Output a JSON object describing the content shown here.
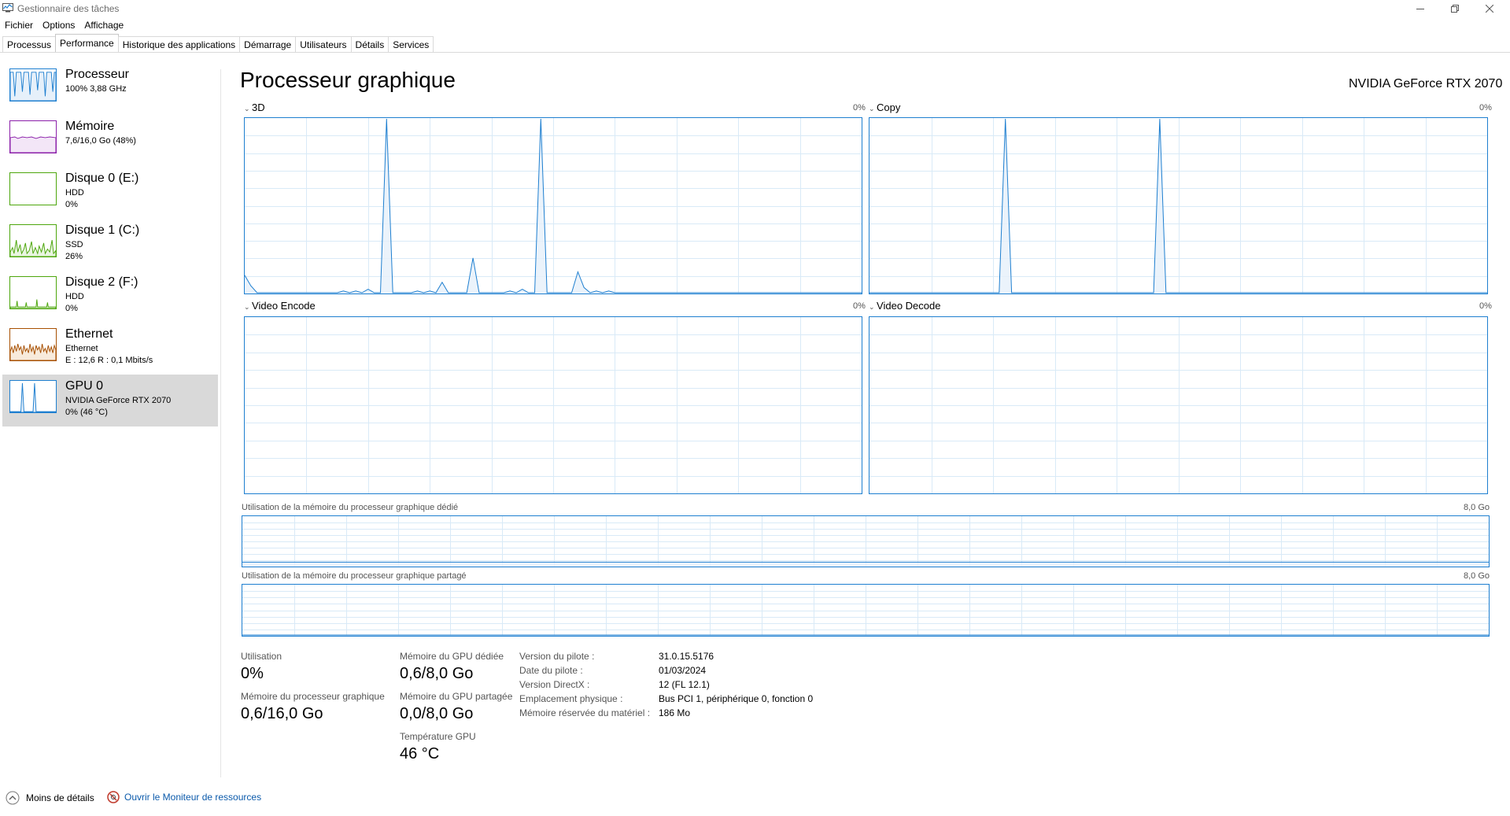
{
  "window": {
    "title": "Gestionnaire des tâches"
  },
  "icons": {
    "app": "task-manager-icon",
    "minimize": "minimize-icon",
    "restore": "restore-icon",
    "close": "close-icon",
    "less_details": "chevron-up-circle-icon",
    "resource_monitor": "resource-monitor-icon"
  },
  "menu": [
    "Fichier",
    "Options",
    "Affichage"
  ],
  "tabs": [
    "Processus",
    "Performance",
    "Historique des applications",
    "Démarrage",
    "Utilisateurs",
    "Détails",
    "Services"
  ],
  "sidebar": [
    {
      "title": "Processeur",
      "lines": [
        "100% 3,88 GHz"
      ],
      "color": "#1e7fd0"
    },
    {
      "title": "Mémoire",
      "lines": [
        "7,6/16,0 Go (48%)"
      ],
      "color": "#8b1fa9"
    },
    {
      "title": "Disque 0 (E:)",
      "lines": [
        "HDD",
        "0%"
      ],
      "color": "#4da60c"
    },
    {
      "title": "Disque 1 (C:)",
      "lines": [
        "SSD",
        "26%"
      ],
      "color": "#4da60c"
    },
    {
      "title": "Disque 2 (F:)",
      "lines": [
        "HDD",
        "0%"
      ],
      "color": "#4da60c"
    },
    {
      "title": "Ethernet",
      "lines": [
        "Ethernet",
        "E : 12,6 R : 0,1 Mbits/s"
      ],
      "color": "#a74f01"
    },
    {
      "title": "GPU 0",
      "lines": [
        "NVIDIA GeForce RTX 2070",
        "0%  (46 °C)"
      ],
      "color": "#1e7fd0"
    }
  ],
  "main": {
    "title": "Processeur graphique",
    "device": "NVIDIA GeForce RTX 2070",
    "engines": [
      {
        "label": "3D",
        "pct": "0%"
      },
      {
        "label": "Copy",
        "pct": "0%"
      },
      {
        "label": "Video Encode",
        "pct": "0%"
      },
      {
        "label": "Video Decode",
        "pct": "0%"
      }
    ],
    "mem_dedicated": {
      "label": "Utilisation de la mémoire du processeur graphique dédié",
      "max": "8,0 Go"
    },
    "mem_shared": {
      "label": "Utilisation de la mémoire du processeur graphique partagé",
      "max": "8,0 Go"
    }
  },
  "stats": {
    "utilisation": {
      "label": "Utilisation",
      "value": "0%"
    },
    "gpu_mem": {
      "label": "Mémoire du processeur graphique",
      "value": "0,6/16,0 Go"
    },
    "dedicated": {
      "label": "Mémoire du GPU dédiée",
      "value": "0,6/8,0 Go"
    },
    "shared": {
      "label": "Mémoire du GPU partagée",
      "value": "0,0/8,0 Go"
    },
    "temp": {
      "label": "Température GPU",
      "value": "46 °C"
    }
  },
  "properties": [
    {
      "key": "Version du pilote :",
      "value": "31.0.15.5176"
    },
    {
      "key": "Date du pilote :",
      "value": "01/03/2024"
    },
    {
      "key": "Version DirectX :",
      "value": "12 (FL 12.1)"
    },
    {
      "key": "Emplacement physique :",
      "value": "Bus PCI 1, périphérique 0, fonction 0"
    },
    {
      "key": "Mémoire réservée du matériel :",
      "value": "186 Mo"
    }
  ],
  "footer": {
    "less_details": "Moins de détails",
    "resource_monitor": "Ouvrir le Moniteur de ressources"
  },
  "chart_data": [
    {
      "type": "area",
      "title": "3D",
      "ylim": [
        0,
        100
      ],
      "values": [
        10,
        4,
        0,
        0,
        0,
        0,
        0,
        0,
        0,
        0,
        0,
        0,
        0,
        0,
        0,
        0,
        1,
        0,
        1,
        0,
        2,
        0,
        0,
        100,
        0,
        0,
        0,
        0,
        1,
        0,
        1,
        0,
        6,
        0,
        0,
        0,
        0,
        20,
        0,
        0,
        0,
        0,
        0,
        1,
        0,
        2,
        0,
        0,
        100,
        0,
        0,
        0,
        0,
        0,
        12,
        3,
        0,
        1,
        0,
        1,
        0,
        0,
        0,
        0,
        0,
        0,
        0,
        0,
        0,
        0,
        0,
        0,
        0,
        0,
        0,
        0,
        0,
        0,
        0,
        0,
        0,
        0,
        0,
        0,
        0,
        0,
        0,
        0,
        0,
        0,
        0,
        0,
        0,
        0,
        0,
        0,
        0,
        0,
        0,
        0,
        0
      ]
    },
    {
      "type": "area",
      "title": "Copy",
      "ylim": [
        0,
        100
      ],
      "values": [
        0,
        0,
        0,
        0,
        0,
        0,
        0,
        0,
        0,
        0,
        0,
        0,
        0,
        0,
        0,
        0,
        0,
        0,
        0,
        0,
        0,
        0,
        100,
        0,
        0,
        0,
        0,
        0,
        0,
        0,
        0,
        0,
        0,
        0,
        0,
        0,
        0,
        0,
        0,
        0,
        0,
        0,
        0,
        0,
        0,
        0,
        0,
        100,
        0,
        0,
        0,
        0,
        0,
        0,
        0,
        0,
        0,
        0,
        0,
        0,
        0,
        0,
        0,
        0,
        0,
        0,
        0,
        0,
        0,
        0,
        0,
        0,
        0,
        0,
        0,
        0,
        0,
        0,
        0,
        0,
        0,
        0,
        0,
        0,
        0,
        0,
        0,
        0,
        0,
        0,
        0,
        0,
        0,
        0,
        0,
        0,
        0,
        0,
        0,
        0,
        0
      ]
    },
    {
      "type": "area",
      "title": "Video Encode",
      "ylim": [
        0,
        100
      ],
      "values": []
    },
    {
      "type": "area",
      "title": "Video Decode",
      "ylim": [
        0,
        100
      ],
      "values": []
    },
    {
      "type": "area",
      "title": "Utilisation de la mémoire du processeur graphique dédié",
      "ylim": [
        0,
        8.0
      ],
      "values": [
        0.6,
        0.6
      ]
    },
    {
      "type": "area",
      "title": "Utilisation de la mémoire du processeur graphique partagé",
      "ylim": [
        0,
        8.0
      ],
      "values": [
        0.0,
        0.0
      ]
    }
  ]
}
